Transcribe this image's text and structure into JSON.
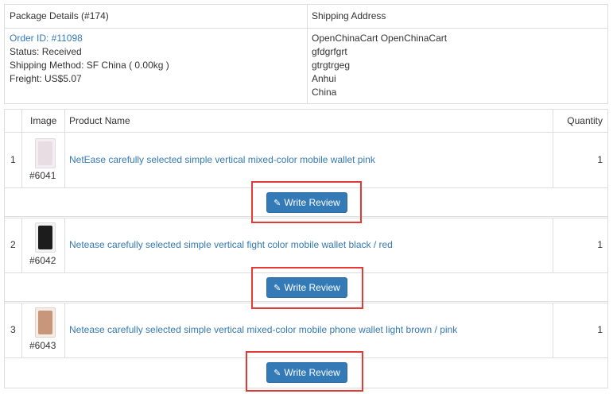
{
  "package": {
    "details_header": "Package Details (#174)",
    "shipping_header": "Shipping Address",
    "order_id": "Order ID: #11098",
    "status": "Status: Received",
    "shipping_method": "Shipping Method: SF China ( 0.00kg )",
    "freight": "Freight: US$5.07",
    "address": [
      "OpenChinaCart OpenChinaCart",
      "gfdgrfgrt",
      "gtrgtrgeg",
      "Anhui",
      "China"
    ]
  },
  "products": {
    "columns": {
      "index": "",
      "image": "Image",
      "name": "Product Name",
      "quantity": "Quantity"
    },
    "items": [
      {
        "index": "1",
        "sku": "#6041",
        "name": "NetEase carefully selected simple vertical mixed-color mobile wallet pink",
        "quantity": "1",
        "thumb_color": "#e8dde3",
        "review_label": "Write Review"
      },
      {
        "index": "2",
        "sku": "#6042",
        "name": "Netease carefully selected simple vertical fight color mobile wallet black / red",
        "quantity": "1",
        "thumb_color": "#1c1c1c",
        "review_label": "Write Review"
      },
      {
        "index": "3",
        "sku": "#6043",
        "name": "Netease carefully selected simple vertical mixed-color mobile phone wallet light brown / pink",
        "quantity": "1",
        "thumb_color": "#c8967a",
        "review_label": "Write Review"
      }
    ]
  },
  "colors": {
    "link": "#337ab7",
    "button": "#337ab7",
    "highlight": "#e53935"
  }
}
